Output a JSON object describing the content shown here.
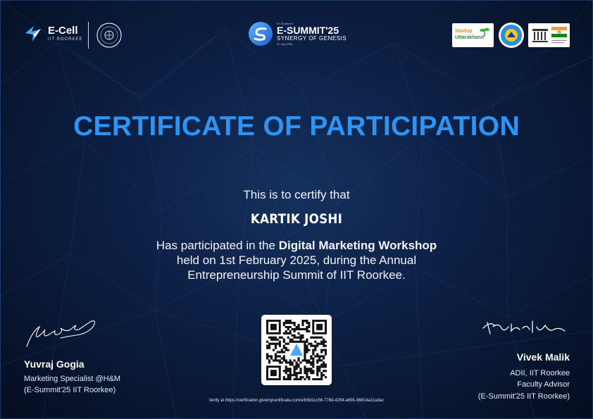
{
  "header": {
    "ecell_name": "E-Cell",
    "ecell_sub": "IIT ROORKEE",
    "esummit_top": "IIT Roorkee's",
    "esummit_title": "E-SUMMIT'25",
    "esummit_tagline": "SYNERGY OF GENESIS",
    "esummit_date": "31 Jan-2Feb",
    "startup_line1": "Startup",
    "startup_line2": "Uttarakhand"
  },
  "certificate": {
    "title": "CERTIFICATE OF PARTICIPATION",
    "intro": "This is to certify that",
    "recipient": "KARTIK JOSHI",
    "body_prefix": "Has participated in the ",
    "event_name": "Digital Marketing Workshop",
    "body_line2": "held on 1st February 2025, during the Annual",
    "body_line3": "Entrepreneurship Summit of IIT Roorkee."
  },
  "signatories": {
    "left": {
      "name": "Yuvraj Gogia",
      "role": "Marketing Specialist @H&M",
      "org": "(E-Summit'25 IIT Roorkee)"
    },
    "right": {
      "name": "Vivek Malik",
      "line1": "ADII, IIT Roorkee",
      "line2": "Faculty Advisor",
      "line3": "(E-Summit'25 IIT Roorkee)"
    }
  },
  "verify_text": "Verify at https://verification.givemycertificate.com/v/b9d1cc56-778d-4294-a691-86814a11a3ac",
  "colors": {
    "title": "#2e93f2",
    "background": "#0d2147"
  }
}
